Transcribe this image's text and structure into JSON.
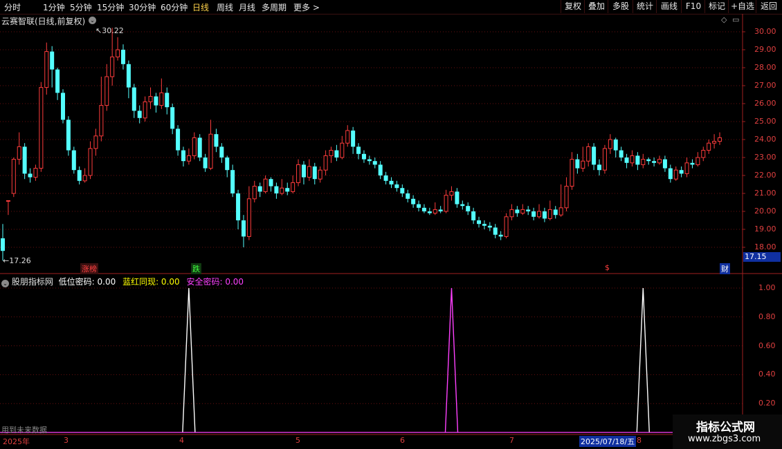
{
  "toolbar": {
    "periods": [
      "分时",
      "1分钟",
      "5分钟",
      "15分钟",
      "30分钟",
      "60分钟",
      "日线",
      "周线",
      "月线",
      "多周期",
      "更多 >"
    ],
    "active_period": "日线",
    "buttons": [
      "复权",
      "叠加",
      "多股",
      "统计",
      "画线",
      "F10",
      "标记",
      "+自选",
      "返回"
    ]
  },
  "stock": {
    "title": "云赛智联(日线,前复权)",
    "high_label": "30.22",
    "low_label": "17.26",
    "current_price": "17.15",
    "tag_limit_up": "涨榜",
    "tag_drop": "跌",
    "tag_dollar": "$",
    "tag_finance": "财"
  },
  "price_axis": {
    "labels": [
      "30.00",
      "29.00",
      "28.00",
      "27.00",
      "26.00",
      "25.00",
      "24.00",
      "23.00",
      "22.00",
      "21.00",
      "20.00",
      "19.00",
      "18.00"
    ]
  },
  "indicator": {
    "name": "股朋指标网",
    "items": [
      {
        "label": "低位密码: 0.00",
        "color": "#ffffff"
      },
      {
        "label": "蓝红同现: 0.00",
        "color": "#ffff00"
      },
      {
        "label": "安全密码: 0.00",
        "color": "#ff40ff"
      }
    ],
    "axis_labels": [
      "1.00",
      "0.80",
      "0.60",
      "0.40",
      "0.20"
    ],
    "footnote": "用到未来数据"
  },
  "date_axis": {
    "labels": [
      "2025年",
      "3",
      "4",
      "5",
      "6",
      "7",
      "2025/07/18/五",
      "8"
    ]
  },
  "watermark": {
    "title": "指标公式网",
    "url": "www.zbgs3.com"
  },
  "colors": {
    "up": "#ff3c3c",
    "down": "#54ffff",
    "grid": "#6a1010",
    "axis": "#e04040",
    "spike_white": "#ffffff",
    "spike_magenta": "#ff40ff"
  },
  "chart_data": {
    "type": "candlestick",
    "y_range": [
      17.26,
      30.22
    ],
    "candles": [
      [
        18.5,
        17.8,
        19.3,
        17.26
      ],
      [
        20.6,
        20.6,
        20.6,
        19.8
      ],
      [
        21.0,
        22.9,
        23.0,
        20.8
      ],
      [
        22.9,
        23.6,
        24.4,
        22.6
      ],
      [
        23.6,
        22.1,
        23.8,
        21.8
      ],
      [
        22.1,
        21.9,
        22.4,
        21.6
      ],
      [
        21.9,
        22.4,
        22.6,
        21.7
      ],
      [
        22.4,
        26.9,
        27.2,
        22.2
      ],
      [
        26.9,
        28.9,
        29.4,
        26.5
      ],
      [
        28.9,
        27.9,
        29.2,
        26.9
      ],
      [
        27.9,
        26.6,
        28.0,
        26.2
      ],
      [
        26.6,
        25.1,
        26.8,
        24.9
      ],
      [
        25.1,
        23.4,
        25.3,
        23.1
      ],
      [
        23.4,
        22.3,
        23.6,
        22.1
      ],
      [
        22.3,
        21.7,
        22.5,
        21.5
      ],
      [
        21.7,
        22.0,
        22.4,
        21.6
      ],
      [
        22.0,
        23.5,
        23.9,
        21.8
      ],
      [
        23.5,
        24.2,
        24.6,
        23.1
      ],
      [
        24.2,
        25.9,
        27.5,
        23.9
      ],
      [
        25.9,
        27.5,
        28.2,
        25.6
      ],
      [
        27.5,
        28.6,
        30.22,
        27.0
      ],
      [
        28.6,
        29.0,
        29.7,
        28.4
      ],
      [
        29.0,
        28.2,
        29.3,
        27.9
      ],
      [
        28.2,
        26.9,
        28.4,
        26.3
      ],
      [
        26.9,
        25.6,
        27.1,
        25.2
      ],
      [
        25.6,
        25.2,
        25.9,
        24.9
      ],
      [
        25.2,
        26.1,
        26.4,
        25.0
      ],
      [
        26.1,
        26.4,
        26.9,
        25.7
      ],
      [
        26.4,
        25.9,
        26.6,
        25.5
      ],
      [
        25.9,
        26.6,
        27.4,
        25.7
      ],
      [
        26.6,
        25.8,
        26.9,
        25.4
      ],
      [
        25.8,
        24.6,
        26.0,
        24.3
      ],
      [
        24.6,
        23.4,
        24.8,
        23.1
      ],
      [
        23.4,
        22.8,
        23.6,
        22.5
      ],
      [
        22.8,
        23.1,
        23.5,
        22.6
      ],
      [
        23.1,
        24.1,
        24.4,
        22.9
      ],
      [
        24.1,
        23.0,
        24.3,
        22.8
      ],
      [
        23.0,
        22.4,
        23.2,
        22.2
      ],
      [
        22.4,
        24.3,
        25.1,
        22.3
      ],
      [
        24.3,
        23.6,
        24.6,
        23.3
      ],
      [
        23.6,
        23.0,
        23.8,
        22.7
      ],
      [
        23.0,
        22.3,
        23.1,
        21.9
      ],
      [
        22.3,
        21.0,
        22.6,
        20.8
      ],
      [
        21.0,
        19.5,
        21.2,
        19.0
      ],
      [
        19.5,
        18.6,
        19.8,
        18.0
      ],
      [
        18.6,
        20.7,
        21.4,
        18.4
      ],
      [
        20.7,
        21.4,
        21.7,
        20.5
      ],
      [
        21.4,
        21.1,
        21.6,
        20.8
      ],
      [
        21.1,
        21.8,
        22.0,
        21.0
      ],
      [
        21.8,
        21.4,
        21.9,
        21.1
      ],
      [
        21.4,
        21.0,
        21.6,
        20.7
      ],
      [
        21.0,
        21.3,
        21.8,
        20.9
      ],
      [
        21.3,
        21.1,
        21.6,
        20.9
      ],
      [
        21.1,
        21.6,
        22.0,
        21.0
      ],
      [
        21.6,
        22.6,
        22.9,
        21.4
      ],
      [
        22.6,
        21.9,
        22.8,
        21.5
      ],
      [
        21.9,
        22.5,
        22.9,
        21.7
      ],
      [
        22.5,
        21.8,
        22.7,
        21.5
      ],
      [
        21.8,
        22.3,
        22.5,
        21.6
      ],
      [
        22.3,
        23.1,
        23.4,
        22.0
      ],
      [
        23.1,
        23.4,
        23.6,
        22.7
      ],
      [
        23.4,
        23.0,
        23.7,
        22.8
      ],
      [
        23.0,
        23.8,
        24.2,
        22.9
      ],
      [
        23.8,
        24.5,
        24.8,
        23.6
      ],
      [
        24.5,
        23.6,
        24.7,
        23.2
      ],
      [
        23.6,
        23.2,
        23.8,
        22.9
      ],
      [
        23.2,
        22.9,
        23.4,
        22.7
      ],
      [
        22.9,
        22.8,
        23.1,
        22.6
      ],
      [
        22.8,
        22.6,
        23.0,
        22.4
      ],
      [
        22.6,
        22.0,
        22.8,
        21.8
      ],
      [
        22.0,
        21.7,
        22.2,
        21.5
      ],
      [
        21.7,
        21.5,
        21.9,
        21.3
      ],
      [
        21.5,
        21.3,
        21.7,
        21.1
      ],
      [
        21.3,
        21.0,
        21.5,
        20.8
      ],
      [
        21.0,
        20.7,
        21.2,
        20.5
      ],
      [
        20.7,
        20.4,
        20.9,
        20.2
      ],
      [
        20.4,
        20.2,
        20.6,
        20.0
      ],
      [
        20.2,
        20.0,
        20.4,
        19.9
      ],
      [
        20.0,
        19.9,
        20.2,
        19.8
      ],
      [
        19.9,
        20.1,
        20.5,
        19.8
      ],
      [
        20.1,
        20.0,
        20.3,
        19.9
      ],
      [
        20.0,
        20.9,
        21.2,
        19.9
      ],
      [
        20.9,
        21.1,
        21.4,
        20.6
      ],
      [
        21.1,
        20.4,
        21.3,
        20.2
      ],
      [
        20.4,
        20.3,
        20.6,
        20.1
      ],
      [
        20.3,
        20.0,
        20.5,
        19.8
      ],
      [
        20.0,
        19.5,
        20.2,
        19.3
      ],
      [
        19.5,
        19.3,
        19.7,
        19.1
      ],
      [
        19.3,
        19.2,
        19.5,
        19.0
      ],
      [
        19.2,
        19.1,
        19.4,
        18.9
      ],
      [
        19.1,
        18.7,
        19.3,
        18.5
      ],
      [
        18.7,
        18.6,
        18.9,
        18.4
      ],
      [
        18.6,
        19.7,
        19.9,
        18.5
      ],
      [
        19.7,
        20.1,
        20.4,
        19.5
      ],
      [
        20.1,
        19.9,
        20.3,
        19.7
      ],
      [
        19.9,
        20.1,
        20.4,
        19.8
      ],
      [
        20.1,
        20.0,
        20.3,
        19.8
      ],
      [
        20.0,
        19.7,
        20.2,
        19.5
      ],
      [
        19.7,
        20.0,
        20.4,
        19.6
      ],
      [
        20.0,
        19.6,
        20.2,
        19.4
      ],
      [
        19.6,
        20.1,
        20.6,
        19.5
      ],
      [
        20.1,
        19.8,
        20.3,
        19.6
      ],
      [
        19.8,
        20.2,
        21.5,
        19.7
      ],
      [
        20.2,
        21.4,
        21.9,
        20.0
      ],
      [
        21.4,
        22.9,
        23.3,
        21.2
      ],
      [
        22.9,
        22.4,
        23.2,
        22.1
      ],
      [
        22.4,
        22.8,
        23.6,
        22.2
      ],
      [
        22.8,
        23.6,
        23.8,
        22.5
      ],
      [
        23.6,
        22.6,
        23.8,
        22.3
      ],
      [
        22.6,
        22.3,
        22.9,
        22.0
      ],
      [
        22.3,
        23.5,
        23.7,
        22.1
      ],
      [
        23.5,
        24.0,
        24.3,
        23.2
      ],
      [
        24.0,
        23.4,
        24.1,
        23.0
      ],
      [
        23.4,
        23.0,
        23.6,
        22.8
      ],
      [
        23.0,
        22.7,
        23.2,
        22.4
      ],
      [
        22.7,
        23.1,
        23.4,
        22.5
      ],
      [
        23.1,
        22.6,
        23.3,
        22.3
      ],
      [
        22.6,
        22.9,
        23.2,
        22.4
      ],
      [
        22.9,
        22.8,
        23.0,
        22.6
      ],
      [
        22.8,
        22.7,
        23.0,
        22.5
      ],
      [
        22.7,
        22.9,
        23.1,
        22.6
      ],
      [
        22.9,
        22.4,
        23.1,
        22.2
      ],
      [
        22.4,
        21.8,
        22.6,
        21.6
      ],
      [
        21.8,
        22.3,
        22.5,
        21.7
      ],
      [
        22.3,
        22.1,
        22.5,
        21.9
      ],
      [
        22.1,
        22.7,
        23.0,
        21.9
      ],
      [
        22.7,
        22.6,
        22.9,
        22.4
      ],
      [
        22.6,
        23.0,
        23.3,
        22.5
      ],
      [
        23.0,
        23.4,
        23.6,
        22.8
      ],
      [
        23.4,
        23.8,
        24.0,
        23.2
      ],
      [
        23.8,
        23.9,
        24.3,
        23.5
      ],
      [
        23.9,
        24.1,
        24.4,
        23.7
      ]
    ],
    "indicator_series": {
      "spikes": [
        {
          "date_index": 34,
          "value": 1.0,
          "color": "white"
        },
        {
          "date_index": 82,
          "value": 1.0,
          "color": "magenta"
        },
        {
          "date_index": 117,
          "value": 1.0,
          "color": "white"
        }
      ],
      "ylim": [
        0,
        1.0
      ]
    }
  }
}
